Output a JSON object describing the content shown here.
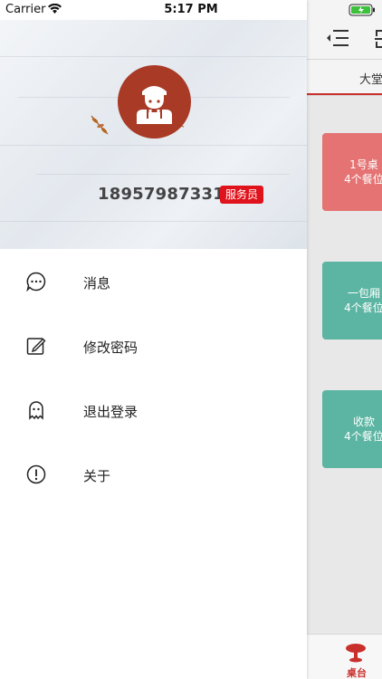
{
  "status_bar": {
    "carrier": "Carrier",
    "time": "5:17 PM"
  },
  "profile": {
    "phone": "18957987331",
    "role_badge": "服务员",
    "avatar_icon": "waiter-avatar-icon"
  },
  "menu": {
    "items": [
      {
        "label": "消息",
        "icon": "message-icon"
      },
      {
        "label": "修改密码",
        "icon": "edit-icon"
      },
      {
        "label": "退出登录",
        "icon": "ghost-icon"
      },
      {
        "label": "关于",
        "icon": "info-icon"
      }
    ]
  },
  "background_app": {
    "tab_label": "大堂",
    "tables": [
      {
        "name": "1号桌",
        "seats": "4个餐位",
        "color": "#e57373"
      },
      {
        "name": "一包厢",
        "seats": "4个餐位",
        "color": "#5bb5a2"
      },
      {
        "name": "收款",
        "seats": "4个餐位",
        "color": "#5bb5a2"
      }
    ],
    "bottom_tab_label": "桌台"
  },
  "colors": {
    "accent_red": "#c9302c",
    "badge_red": "#e0121b",
    "avatar_brown": "#a83a26"
  }
}
